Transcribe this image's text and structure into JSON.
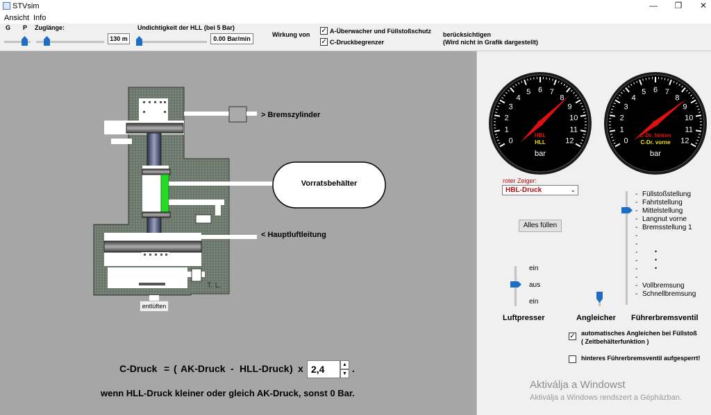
{
  "window": {
    "title": "STVsim",
    "minimize": "—",
    "maximize": "❐",
    "close": "✕"
  },
  "menu": [
    "Ansicht",
    "Info"
  ],
  "toolbar": {
    "g_label": "G",
    "p_label": "P",
    "zuglaenge_label": "Zuglänge:",
    "zuglaenge_value": "130 m",
    "undicht_label": "Undichtigkeit der HLL (bei 5 Bar)",
    "undicht_value": "0.00 Bar/min",
    "wirkung_label": "Wirkung von",
    "chk1_label": "A-Überwacher und Füllstoßschutz",
    "chk2_label": "C-Druckbegrenzer",
    "chk1_checked": true,
    "chk2_checked": true,
    "beruecksichtigen_1": "berücksichtigen",
    "beruecksichtigen_2": "(Wird nicht in Grafik dargestellt)"
  },
  "diagram": {
    "bremszylinder": "> Bremszylinder",
    "vorratsbehaelter": "Vorratsbehälter",
    "hauptluftleitung": "< Hauptluftleitung",
    "tl_mark": "T. L.",
    "entlueften": "entlüften"
  },
  "formula": {
    "c_druck": "C-Druck",
    "eq": "=",
    "paren_open": "(",
    "ak": "AK-Druck",
    "minus": "-",
    "hll": "HLL-Druck",
    "paren_close": ")",
    "times": "x",
    "factor": "2,4",
    "dot": ".",
    "condition": "wenn HLL-Druck kleiner oder gleich AK-Druck, sonst 0 Bar."
  },
  "gauges": {
    "ticks": [
      "0",
      "1",
      "2",
      "3",
      "4",
      "5",
      "6",
      "7",
      "8",
      "9",
      "10",
      "11",
      "12"
    ],
    "unit": "bar",
    "left_label_red": "HBL",
    "left_label_yellow": "HLL",
    "right_label_red": "C-Dr. hinten",
    "right_label_yellow": "C-Dr. vorne",
    "left_needle_value": 8.3,
    "right_needle_value": 8.6,
    "colors": {
      "red": "#e01010",
      "yellow": "#f0e020",
      "face": "#000000"
    }
  },
  "controls": {
    "roter_zeiger_label": "roter Zeiger:",
    "roter_zeiger_value": "HBL-Druck",
    "alles_fuellen": "Alles füllen",
    "luftpresser_ein1": "ein",
    "luftpresser_aus": "aus",
    "luftpresser_ein2": "ein",
    "luftpresser_label": "Luftpresser",
    "angleicher_label": "Angleicher",
    "fbv_label": "Führerbremsventil",
    "fbv_positions": [
      "Füllstoßstellung",
      "Fahrtstellung",
      "Mittelstellung",
      "Langnut vorne",
      "Bremsstellung 1",
      "",
      "",
      "",
      "",
      "",
      "",
      "Vollbremsung",
      "Schnellbremsung"
    ],
    "dots": "•",
    "auto_angleichen_1": "automatisches Angleichen bei Füllstoß",
    "auto_angleichen_2": "( Zeitbehälterfunktion )",
    "auto_angleichen_checked": true,
    "hinteres_fbv": "hinteres Führerbremsventil aufgesperrt!",
    "hinteres_fbv_checked": false
  },
  "watermark": {
    "line1": "Aktiválja a Windowst",
    "line2": "Aktiválja a Windows rendszert a Gépházban."
  }
}
